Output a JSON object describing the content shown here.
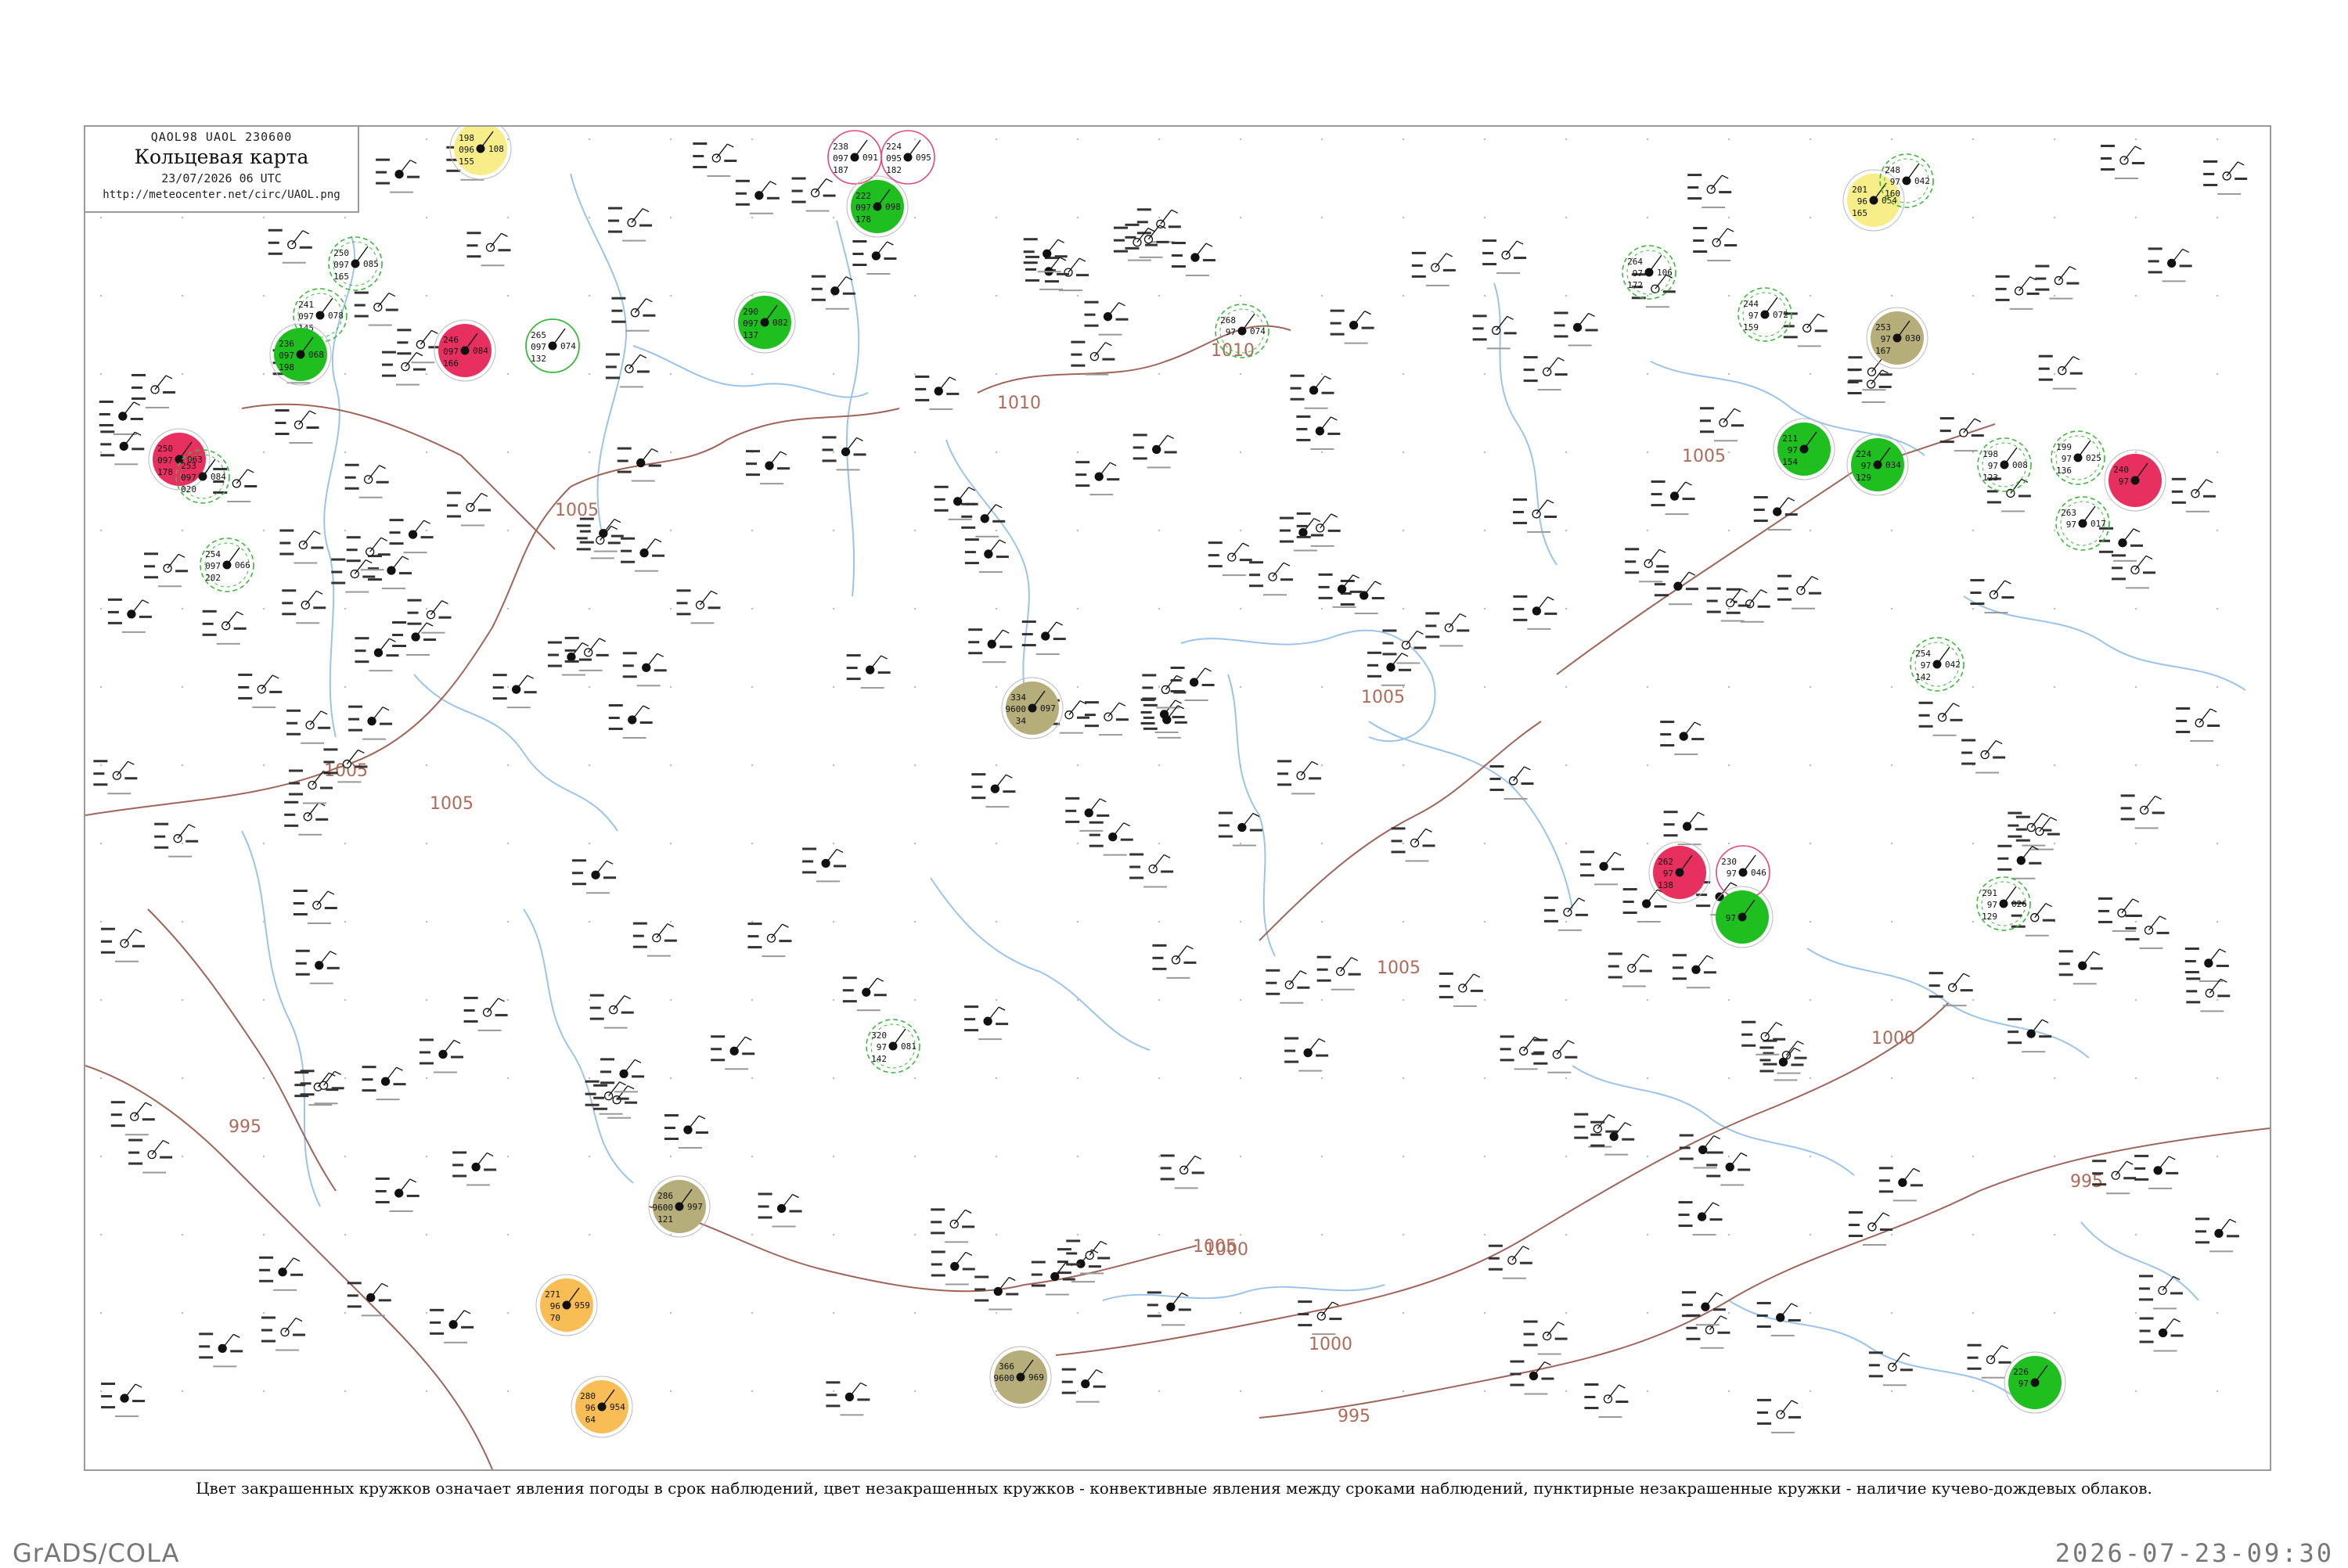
{
  "header": {
    "code_line": "QAOL98  UAOL  230600",
    "title": "Кольцевая карта",
    "date_line": "23/07/2026 06 UTC",
    "url": "http://meteocenter.net/circ/UAOL.png"
  },
  "caption": "Цвет закрашенных кружков означает явления погоды в срок наблюдений, цвет незакрашенных кружков - конвективные явления между сроками наблюдений, пунктирные незакрашенные кружки - наличие кучево-дождевых облаков.",
  "footer": {
    "left": "GrADS/COLA",
    "right": "2026-07-23-09:30"
  },
  "colors": {
    "frame": "#9a9a9a",
    "isobar": "#a0655a",
    "river": "#9cc4ea",
    "thunder_fill": "#1fbf1f",
    "heavy_rain_fill": "#e83060",
    "dust_fill": "#b5ad7a",
    "fog_fill": "#f8bd55",
    "haze_fill": "#f7ee8a",
    "cb_dashed": "#3cb83c",
    "convective_ring": "#e04a7a"
  },
  "isobar_labels": [
    "1010",
    "1010",
    "1005",
    "1005",
    "1005",
    "1005",
    "1005",
    "1005",
    "1005",
    "1000",
    "1000",
    "1000",
    "995",
    "995",
    "995"
  ],
  "stations": [
    {
      "p": "198",
      "t": "096",
      "td": "155",
      "pt": "108",
      "state": "haze"
    },
    {
      "p": "238",
      "t": "097",
      "td": "187",
      "pt": "091",
      "state": "ring"
    },
    {
      "p": "224",
      "t": "095",
      "td": "182",
      "pt": "095",
      "state": "ring"
    },
    {
      "p": "222",
      "t": "097",
      "td": "178",
      "pt": "098",
      "state": "thunder"
    },
    {
      "p": "290",
      "t": "097",
      "td": "137",
      "pt": "082",
      "state": "thunder"
    },
    {
      "p": "246",
      "t": "097",
      "td": "166",
      "pt": "084",
      "state": "heavy_rain"
    },
    {
      "p": "265",
      "t": "097",
      "td": "132",
      "pt": "074",
      "state": "ring_green"
    },
    {
      "p": "250",
      "t": "097",
      "td": "165",
      "pt": "085",
      "state": "cb"
    },
    {
      "p": "241",
      "t": "097",
      "td": "145",
      "pt": "078",
      "state": "cb"
    },
    {
      "p": "236",
      "t": "097",
      "td": "198",
      "pt": "068",
      "state": "thunder"
    },
    {
      "p": "250",
      "t": "097",
      "td": "178",
      "pt": "063",
      "state": "heavy_rain"
    },
    {
      "p": "253",
      "t": "097",
      "td": "020",
      "pt": "084",
      "state": "cb"
    },
    {
      "p": "254",
      "t": "097",
      "td": "202",
      "pt": "066",
      "state": "cb"
    },
    {
      "p": "334",
      "t": "9600",
      "td": "34",
      "pt": "097",
      "state": "dust"
    },
    {
      "p": "286",
      "t": "9600",
      "td": "121",
      "pt": "997",
      "state": "dust"
    },
    {
      "p": "271",
      "t": "96",
      "td": "70",
      "pt": "959",
      "state": "fog"
    },
    {
      "p": "280",
      "t": "96",
      "td": "64",
      "pt": "954",
      "state": "fog"
    },
    {
      "p": "366",
      "t": "9600",
      "td": "",
      "pt": "969",
      "state": "dust"
    },
    {
      "p": "320",
      "t": "97",
      "td": "142",
      "pt": "081",
      "state": "cb"
    },
    {
      "p": "268",
      "t": "97",
      "td": "",
      "pt": "074",
      "state": "cb"
    },
    {
      "p": "264",
      "t": "97",
      "td": "172",
      "pt": "106",
      "state": "cb"
    },
    {
      "p": "244",
      "t": "97",
      "td": "159",
      "pt": "072",
      "state": "cb"
    },
    {
      "p": "201",
      "t": "96",
      "td": "165",
      "pt": "054",
      "state": "haze"
    },
    {
      "p": "248",
      "t": "97",
      "td": "160",
      "pt": "042",
      "state": "cb"
    },
    {
      "p": "253",
      "t": "97",
      "td": "167",
      "pt": "030",
      "state": "dust"
    },
    {
      "p": "211",
      "t": "97",
      "td": "154",
      "pt": "",
      "state": "thunder"
    },
    {
      "p": "224",
      "t": "97",
      "td": "129",
      "pt": "034",
      "state": "thunder"
    },
    {
      "p": "198",
      "t": "97",
      "td": "123",
      "pt": "008",
      "state": "cb"
    },
    {
      "p": "199",
      "t": "97",
      "td": "136",
      "pt": "025",
      "state": "cb"
    },
    {
      "p": "240",
      "t": "97",
      "td": "",
      "pt": "",
      "state": "heavy_rain"
    },
    {
      "p": "263",
      "t": "97",
      "td": "",
      "pt": "017",
      "state": "cb"
    },
    {
      "p": "254",
      "t": "97",
      "td": "142",
      "pt": "042",
      "state": "cb"
    },
    {
      "p": "262",
      "t": "97",
      "td": "138",
      "pt": "",
      "state": "heavy_rain"
    },
    {
      "p": "230",
      "t": "97",
      "td": "",
      "pt": "046",
      "state": "ring"
    },
    {
      "p": "",
      "t": "97",
      "td": "",
      "pt": "",
      "state": "thunder"
    },
    {
      "p": "291",
      "t": "97",
      "td": "129",
      "pt": "026",
      "state": "cb"
    },
    {
      "p": "226",
      "t": "97",
      "td": "",
      "pt": "",
      "state": "thunder"
    }
  ]
}
